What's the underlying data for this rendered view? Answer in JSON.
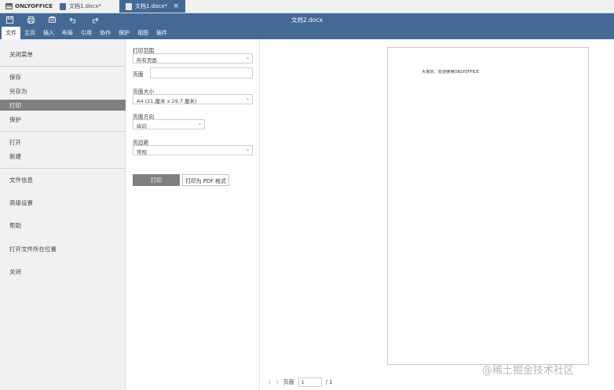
{
  "tabstrip": {
    "brand": "ONLYOFFICE",
    "tabs": [
      {
        "label": "文档1.docx*"
      },
      {
        "label": "文档1.docx*"
      }
    ]
  },
  "header": {
    "title": "文档2.docx",
    "tools": [
      "save-icon",
      "print-icon",
      "quick-print-icon",
      "undo-icon",
      "redo-icon"
    ]
  },
  "menubar": {
    "items": [
      "文件",
      "主页",
      "插入",
      "布局",
      "引用",
      "协作",
      "保护",
      "视图",
      "插件"
    ],
    "active_index": 0
  },
  "file_menu": {
    "items": [
      "关闭菜单",
      "保存",
      "另存为",
      "打印",
      "保护",
      "打开",
      "新建",
      "文件信息",
      "高级设置",
      "帮助",
      "打开文件所在位置",
      "关闭"
    ],
    "selected": "打印"
  },
  "print_settings": {
    "range_label": "打印范围",
    "range_value": "所有页面",
    "pages_label": "页面",
    "pages_value": "",
    "size_label": "页面大小",
    "size_value": "A4 (21,厘米 x 29,7 厘米)",
    "orientation_label": "页面方向",
    "orientation_value": "纵向",
    "margins_label": "页边距",
    "margins_value": "常规",
    "print_button": "打印",
    "pdf_button": "打印为 PDF 格式"
  },
  "preview": {
    "page_text": "大家好，欢迎使用ONLYOFFICE",
    "pager_label": "页面",
    "current_page": "1",
    "total_pages": "/ 1"
  },
  "watermark": "@稀土掘金技术社区",
  "colors": {
    "accent": "#446995",
    "selected": "#7f7f7f"
  }
}
